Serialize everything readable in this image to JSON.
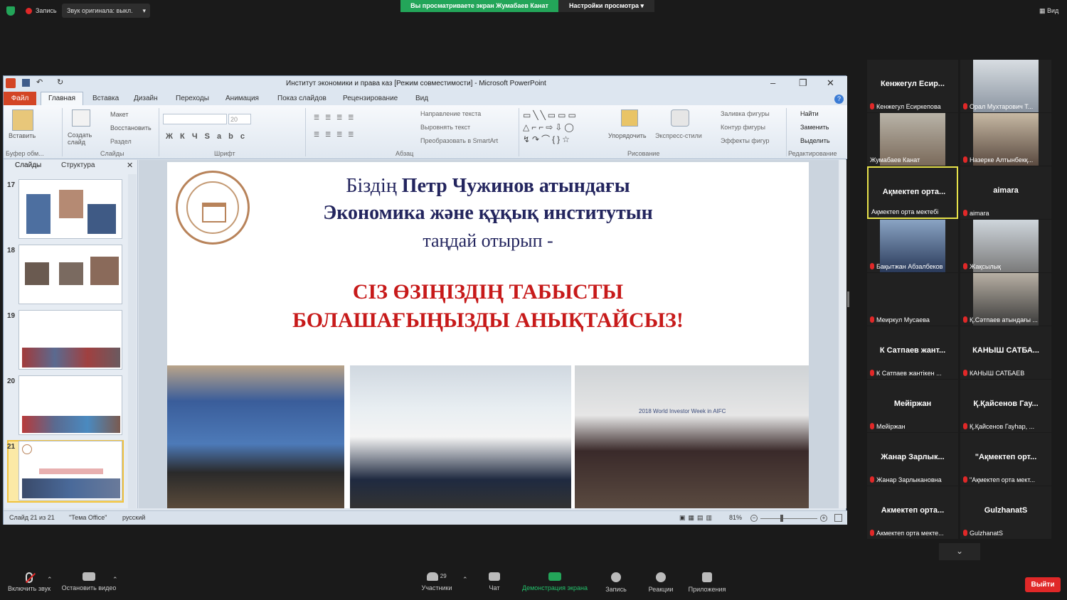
{
  "zoom_top": {
    "record_label": "Запись",
    "source_audio": "Звук оригинала: выкл.",
    "banner": "Вы просматриваете экран Жумабаев Канат",
    "view_settings": "Настройки просмотра",
    "view": "Вид"
  },
  "ppt": {
    "title": "Институт экономики и права каз [Режим совместимости]  -  Microsoft PowerPoint",
    "tabs": [
      "Файл",
      "Главная",
      "Вставка",
      "Дизайн",
      "Переходы",
      "Анимация",
      "Показ слайдов",
      "Рецензирование",
      "Вид"
    ],
    "ribbon": {
      "paste": "Вставить",
      "clipboard": "Буфер обм...",
      "create_slide": "Создать слайд",
      "layout": "Макет",
      "restore": "Восстановить",
      "section": "Раздел",
      "slides_group": "Слайды",
      "font_size": "20",
      "font_group": "Шрифт",
      "text_dir": "Направление текста",
      "align_text": "Выровнять текст",
      "smartart": "Преобразовать в SmartArt",
      "para_group": "Абзац",
      "arrange": "Упорядочить",
      "quick_styles": "Экспресс-стили",
      "fill": "Заливка фигуры",
      "outline": "Контур фигуры",
      "effects": "Эффекты фигур",
      "draw_group": "Рисование",
      "find": "Найти",
      "replace": "Заменить",
      "select": "Выделить",
      "edit_group": "Редактирование"
    },
    "panel_tabs": [
      "Слайды",
      "Структура"
    ],
    "slide_numbers": [
      "17",
      "18",
      "19",
      "20",
      "21"
    ],
    "slide": {
      "line1a": "Біздің ",
      "line1b": "Петр Чужинов атындағы",
      "line2": "Экономика және құқық институтын",
      "line3": "таңдай отырып -",
      "red1": "СІЗ ӨЗІҢІЗДІҢ ТАБЫСТЫ",
      "red2": "БОЛАШАҒЫҢЫЗДЫ АНЫҚТАЙСЫЗ!",
      "photo_banner_text": "2018 World Investor Week in AIFC"
    },
    "status": {
      "slide_of": "Слайд 21 из 21",
      "theme": "\"Тема Office\"",
      "lang": "русский",
      "zoom": "81%"
    }
  },
  "participants": [
    {
      "name": "Кенжегул  Есир...",
      "label": "Кенжегул Есиркепова",
      "video": false
    },
    {
      "name": "",
      "label": "Орал Мухтарович Т...",
      "video": true
    },
    {
      "name": "",
      "label": "Жумабаев Канат",
      "video": true,
      "nomic": true
    },
    {
      "name": "",
      "label": "Назерке Алтынбекқ...",
      "video": true
    },
    {
      "name": "Ақмектеп  орта...",
      "label": "Ақмектеп орта мектебі",
      "video": false,
      "highlight": true,
      "nomic": true
    },
    {
      "name": "aimara",
      "label": "aimara",
      "video": false
    },
    {
      "name": "",
      "label": "Бақытжан Абзалбеков",
      "video": true
    },
    {
      "name": "",
      "label": "Жақсылық",
      "video": true
    },
    {
      "name": "",
      "label": "Меиркул Мусаева",
      "video": false
    },
    {
      "name": "",
      "label": "Қ.Сәтпаев атындағы ...",
      "video": true
    },
    {
      "name": "К Сатпаев  жант...",
      "label": "К Сатпаев жантікен ...",
      "video": false
    },
    {
      "name": "КАНЫШ  САТБА...",
      "label": "КАНЫШ САТБАЕВ",
      "video": false
    },
    {
      "name": "Мейіржан",
      "label": "Мейіржан",
      "video": false
    },
    {
      "name": "Қ.Қайсенов  Гау...",
      "label": "Қ.Қайсенов Гауһар, ...",
      "video": false
    },
    {
      "name": "Жанар  Зарлык...",
      "label": "Жанар Зарлыкановна",
      "video": false
    },
    {
      "name": "\"Ақмектеп  орт...",
      "label": "\"Ақмектеп орта мект...",
      "video": false
    },
    {
      "name": "Акмектеп  орта...",
      "label": "Акмектеп орта мекте...",
      "video": false
    },
    {
      "name": "GulzhanatS",
      "label": "GulzhanatS",
      "video": false
    }
  ],
  "toolbar": {
    "unmute": "Включить звук",
    "stop_video": "Остановить видео",
    "participants": "Участники",
    "participants_count": "29",
    "chat": "Чат",
    "share": "Демонстрация экрана",
    "record": "Запись",
    "reactions": "Реакции",
    "apps": "Приложения",
    "leave": "Выйти"
  },
  "colors": {
    "zoom_green": "#23a559",
    "accent_red": "#e02828",
    "highlight": "#e7e24a",
    "slide_blue": "#23255e",
    "slide_red": "#c71a1a"
  }
}
